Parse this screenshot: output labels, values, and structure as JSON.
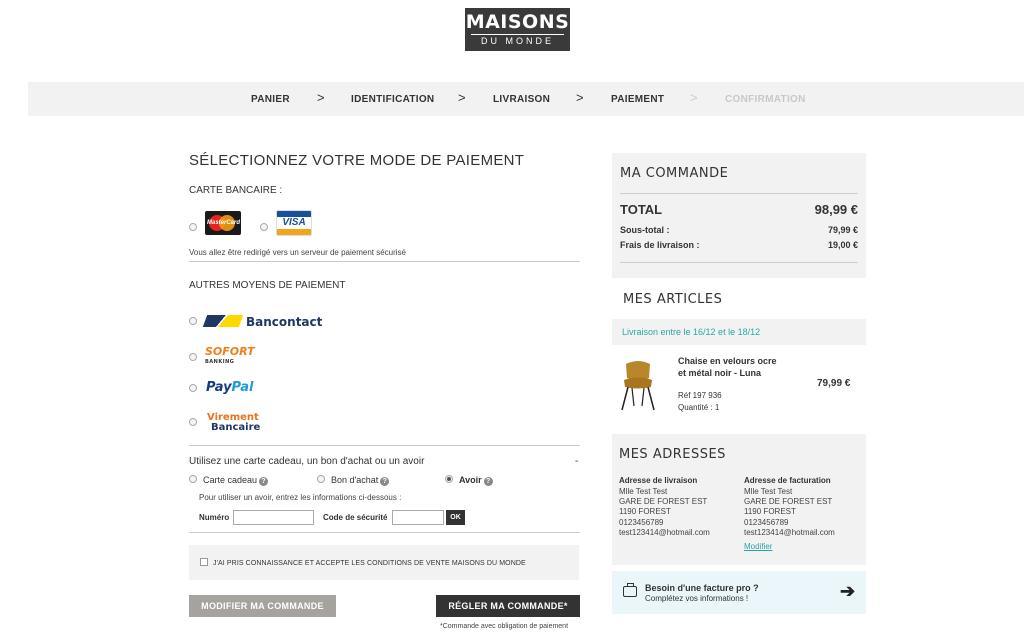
{
  "brand": {
    "line1": "MAISONS",
    "line2": "DU MONDE"
  },
  "steps": [
    {
      "label": "PANIER",
      "active": true
    },
    {
      "label": "IDENTIFICATION",
      "active": true
    },
    {
      "label": "LIVRAISON",
      "active": true
    },
    {
      "label": "PAIEMENT",
      "active": true
    },
    {
      "label": "CONFIRMATION",
      "active": false
    }
  ],
  "step_separator": ">",
  "payment": {
    "title": "SÉLECTIONNEZ VOTRE MODE DE PAIEMENT",
    "card_section": "CARTE BANCAIRE :",
    "cards": [
      "MasterCard",
      "VISA"
    ],
    "card_note": "Vous allez être redirigé vers un serveur de paiement sécurisé",
    "other_section": "AUTRES MOYENS DE PAIEMENT",
    "methods": {
      "bancontact": "Bancontact",
      "sofort": "SOFORT",
      "sofort_sub": "BANKING",
      "paypal_1": "Pay",
      "paypal_2": "Pal",
      "virement_1": "Virement",
      "virement_2": "Bancaire"
    }
  },
  "voucher": {
    "title": "Utilisez une carte cadeau, un bon d'achat ou un avoir",
    "collapse": "-",
    "options": [
      "Carte cadeau",
      "Bon d'achat",
      "Avoir"
    ],
    "selected": "Avoir",
    "help_icon": "?",
    "instructions": "Pour utiliser un avoir, entrez les informations ci-dessous :",
    "numero_label": "Numéro",
    "numero_value": "",
    "code_label": "Code de sécurité",
    "code_value": "",
    "ok_label": "OK"
  },
  "cgv": {
    "label": "J'AI PRIS CONNAISSANCE ET ACCEPTE LES CONDITIONS DE VENTE MAISONS DU MONDE",
    "checked": false
  },
  "buttons": {
    "modify": "MODIFIER MA COMMANDE",
    "pay": "RÉGLER MA COMMANDE*",
    "pay_note": "*Commande avec obligation de paiement"
  },
  "order": {
    "title": "MA COMMANDE",
    "total_label": "TOTAL",
    "total_value": "98,99 €",
    "subtotal_label": "Sous-total :",
    "subtotal_value": "79,99 €",
    "shipping_label": "Frais de livraison :",
    "shipping_value": "19,00 €"
  },
  "articles": {
    "title": "MES ARTICLES",
    "delivery": "Livraison entre le 16/12 et le 18/12",
    "item": {
      "name": "Chaise en velours ocre et métal noir - Luna",
      "ref": "Réf 197 936",
      "qty": "Quantité : 1",
      "price": "79,99 €"
    }
  },
  "addresses": {
    "title": "MES ADRESSES",
    "shipping": {
      "heading": "Adresse de livraison",
      "lines": [
        "Mlle Test Test",
        "GARE DE FOREST EST",
        "1190 FOREST",
        "0123456789",
        "test123414@hotmail.com"
      ]
    },
    "billing": {
      "heading": "Adresse de facturation",
      "lines": [
        "Mlle Test Test",
        "GARE DE FOREST EST",
        "1190 FOREST",
        "0123456789",
        "test123414@hotmail.com"
      ]
    },
    "modify_link": "Modifier"
  },
  "pro": {
    "title": "Besoin d'une facture pro ?",
    "subtitle": "Complétez vos informations !",
    "arrow": "➔"
  },
  "colors": {
    "accent": "#2aa6a6",
    "dark": "#333333",
    "panel": "#f2f2f2",
    "button_grey": "#a6a29e"
  }
}
